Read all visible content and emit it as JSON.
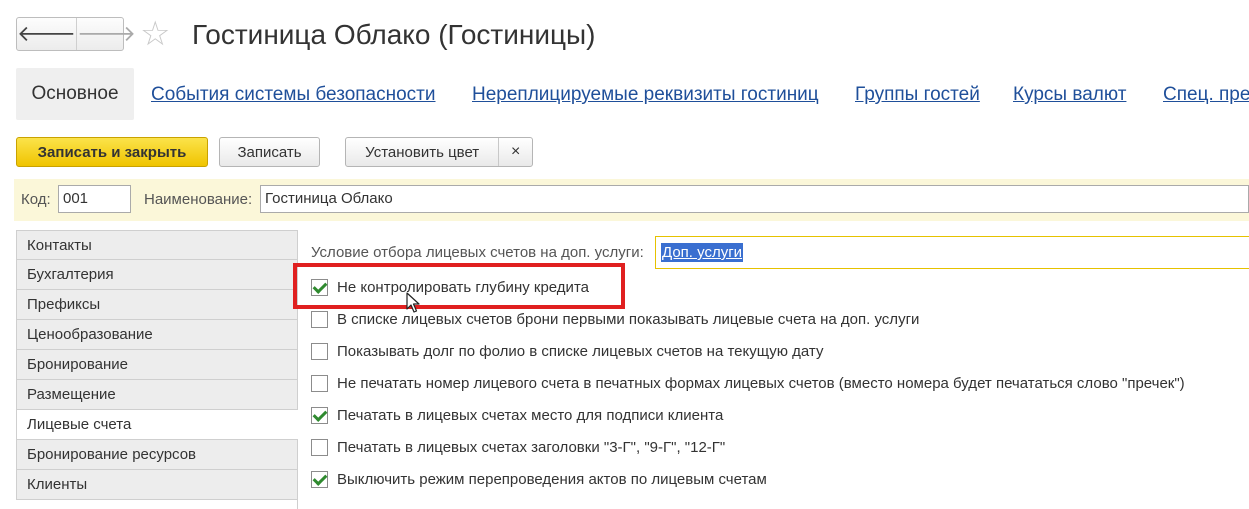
{
  "nav": {
    "back_glyph": "🡐",
    "forward_glyph": "🡒"
  },
  "window": {
    "title": "Гостиница Облако (Гостиницы)"
  },
  "sections": {
    "active": "Основное",
    "links": [
      "События системы безопасности",
      "Нереплицируемые реквизиты гостиниц",
      "Группы гостей",
      "Курсы валют",
      "Спец. пре"
    ]
  },
  "toolbar": {
    "save_close": "Записать и закрыть",
    "save": "Записать",
    "set_color": "Установить цвет",
    "clear_color": "×"
  },
  "fields": {
    "code_label": "Код:",
    "code_value": "001",
    "name_label": "Наименование:",
    "name_value": "Гостиница Облако"
  },
  "pages": [
    "Контакты",
    "Бухгалтерия",
    "Префиксы",
    "Ценообразование",
    "Бронирование",
    "Размещение",
    "Лицевые счета",
    "Бронирование ресурсов",
    "Клиенты"
  ],
  "active_page": "Лицевые счета",
  "folio": {
    "condition_label": "Условие отбора лицевых счетов на доп. услуги:",
    "condition_value": "Доп. услуги",
    "checkboxes": [
      {
        "label": "Не контролировать глубину кредита",
        "checked": true
      },
      {
        "label": "В списке лицевых счетов брони первыми показывать лицевые счета на доп. услуги",
        "checked": false
      },
      {
        "label": "Показывать долг по фолио в списке лицевых счетов на текущую дату",
        "checked": false
      },
      {
        "label": "Не печатать номер лицевого счета в печатных формах лицевых счетов (вместо номера будет печататься слово \"пречек\")",
        "checked": false
      },
      {
        "label": "Печатать в лицевых счетах место для подписи клиента",
        "checked": true
      },
      {
        "label": "Печатать в лицевых счетах заголовки \"3-Г\", \"9-Г\", \"12-Г\"",
        "checked": false
      },
      {
        "label": "Выключить режим перепроведения актов по лицевым счетам",
        "checked": true
      }
    ]
  },
  "colors": {
    "highlight": "#e02020",
    "accent": "#f0c400",
    "link": "#1f4f9a",
    "selection": "#3a6fd0"
  }
}
